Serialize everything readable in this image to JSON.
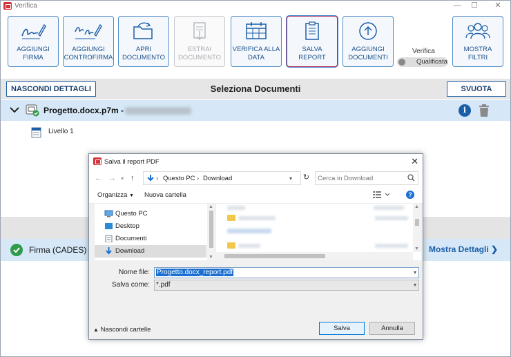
{
  "window": {
    "title": "Verifica",
    "controls": [
      "—",
      "☐",
      "✕"
    ]
  },
  "toolbar": {
    "buttons": [
      {
        "label_1": "AGGIUNGI",
        "label_2": "FIRMA",
        "icon": "signature-pen-icon"
      },
      {
        "label_1": "AGGIUNGI",
        "label_2": "CONTROFIRMA",
        "icon": "countersignature-icon"
      },
      {
        "label_1": "APRI",
        "label_2": "DOCUMENTO",
        "icon": "open-folder-icon"
      },
      {
        "label_1": "ESTRAI",
        "label_2": "DOCUMENTO",
        "icon": "extract-document-icon",
        "disabled": true
      },
      {
        "label_1": "VERIFICA ALLA",
        "label_2": "DATA",
        "icon": "calendar-icon"
      },
      {
        "label_1": "SALVA",
        "label_2": "REPORT",
        "icon": "report-icon",
        "active": true
      },
      {
        "label_1": "AGGIUNGI",
        "label_2": "DOCUMENTI",
        "icon": "upload-icon"
      },
      {
        "label_1": "MOSTRA",
        "label_2": "FILTRI",
        "icon": "users-icon"
      }
    ],
    "verifica_label": "Verifica",
    "toggle_label": "Qualificata"
  },
  "section": {
    "hide_details": "NASCONDI DETTAGLI",
    "title": "Seleziona Documenti",
    "empty": "SVUOTA"
  },
  "document": {
    "name": "Progetto.docx.p7m -"
  },
  "level": {
    "label": "Livello 1"
  },
  "signature": {
    "label": "Firma (CADES) :",
    "details": "Mostra Dettagli"
  },
  "dialog": {
    "title": "Salva il report PDF",
    "breadcrumb": [
      "Questo PC",
      "Download"
    ],
    "search_placeholder": "Cerca in Download",
    "organize": "Organizza",
    "new_folder": "Nuova cartella",
    "tree": [
      {
        "label": "Questo PC",
        "icon": "computer-icon"
      },
      {
        "label": "Desktop",
        "icon": "desktop-icon"
      },
      {
        "label": "Documenti",
        "icon": "documents-icon"
      },
      {
        "label": "Download",
        "icon": "download-icon",
        "selected": true
      }
    ],
    "file_name_label": "Nome file:",
    "file_name_value": "Progetto.docx_report.pdf",
    "save_as_label": "Salva come:",
    "save_as_value": "*.pdf",
    "hide_folders": "Nascondi cartelle",
    "save_button": "Salva",
    "cancel_button": "Annulla"
  }
}
